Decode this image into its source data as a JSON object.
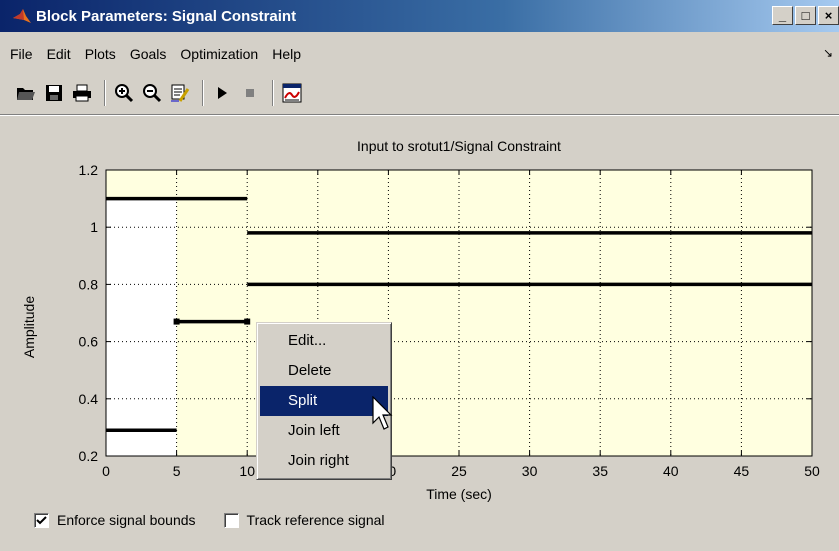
{
  "window": {
    "title": "Block Parameters: Signal Constraint"
  },
  "menubar": {
    "items": [
      "File",
      "Edit",
      "Plots",
      "Goals",
      "Optimization",
      "Help"
    ],
    "overflow": "↘"
  },
  "toolbar": {
    "icons": [
      "open-folder-icon",
      "save-icon",
      "print-icon",
      "zoom-in-icon",
      "zoom-out-icon",
      "edit-constraint-icon",
      "play-icon",
      "stop-icon",
      "plot-display-icon"
    ]
  },
  "plot": {
    "title": "Input to srotut1/Signal Constraint",
    "xlabel": "Time (sec)",
    "ylabel": "Amplitude",
    "background_color": "#ffffe0",
    "constraint_color": "#000000"
  },
  "chart_data": {
    "type": "line",
    "title": "Input to srotut1/Signal Constraint",
    "xlabel": "Time (sec)",
    "ylabel": "Amplitude",
    "xlim": [
      0,
      50
    ],
    "ylim": [
      0.2,
      1.2
    ],
    "grid": true,
    "x_ticks": [
      "0",
      "5",
      "10",
      "15",
      "20",
      "25",
      "30",
      "35",
      "40",
      "45",
      "50"
    ],
    "y_ticks": [
      "0.2",
      "0.4",
      "0.6",
      "0.8",
      "1",
      "1.2"
    ],
    "shaded_regions": [
      {
        "x": [
          0,
          5
        ],
        "y": [
          1.1,
          1.2
        ]
      },
      {
        "x": [
          5,
          50
        ],
        "y": [
          0.2,
          1.2
        ]
      }
    ],
    "upper_bounds": [
      {
        "x": [
          0,
          10
        ],
        "y": [
          1.1,
          1.1
        ]
      },
      {
        "x": [
          10,
          50
        ],
        "y": [
          0.98,
          0.98
        ]
      }
    ],
    "lower_bounds": [
      {
        "x": [
          0,
          5
        ],
        "y": [
          0.29,
          0.29
        ]
      },
      {
        "x": [
          5,
          10
        ],
        "y": [
          0.67,
          0.67
        ]
      },
      {
        "x": [
          10,
          50
        ],
        "y": [
          0.8,
          0.8
        ]
      }
    ]
  },
  "context_menu": {
    "items": [
      {
        "label": "Edit...",
        "selected": false
      },
      {
        "label": "Delete",
        "selected": false
      },
      {
        "label": "Split",
        "selected": true
      },
      {
        "label": "Join left",
        "selected": false
      },
      {
        "label": "Join right",
        "selected": false
      }
    ]
  },
  "options": {
    "enforce_label": "Enforce signal bounds",
    "enforce_checked": true,
    "track_label": "Track reference signal",
    "track_checked": false
  }
}
